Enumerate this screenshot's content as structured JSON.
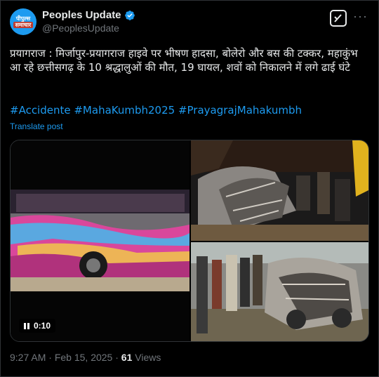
{
  "account": {
    "display_name": "Peoples Update",
    "handle": "@PeoplesUpdate",
    "avatar_line1": "पीपुल्स",
    "avatar_line2": "समाचार"
  },
  "post": {
    "text": "प्रयागराज : मिर्जापुर-प्रयागराज हाइवे पर भीषण हादसा, बोलेरो और बस की टक्कर, महाकुंभ आ रहे छत्तीसगढ़ के 10 श्रद्धालुओं की मौत, 19 घायल, शवों को निकालने में लगे ढाई घंटे",
    "hashtags": "#Accidente #MahaKumbh2025 #PrayagrajMahakumbh",
    "translate_label": "Translate post"
  },
  "media": {
    "video_time": "0:10"
  },
  "meta": {
    "time": "9:27 AM",
    "separator1": " · ",
    "date": "Feb 15, 2025",
    "separator2": " · ",
    "views_count": "61",
    "views_label": " Views"
  },
  "colors": {
    "accent": "#1d9bf0",
    "muted": "#71767b",
    "text": "#e7e9ea",
    "border": "#2f3336"
  },
  "icons": [
    "verified-badge-icon",
    "grok-icon",
    "more-options-icon",
    "pause-icon"
  ]
}
